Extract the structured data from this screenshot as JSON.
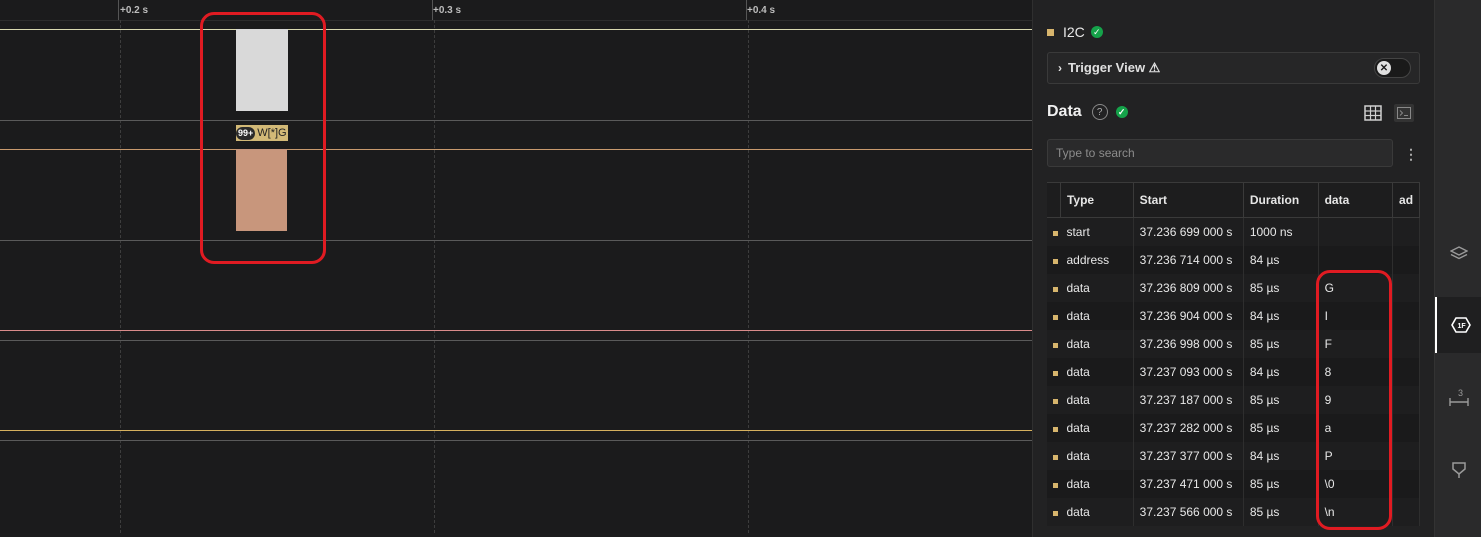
{
  "timeline": {
    "ticks": [
      "+0.2 s",
      "+0.3 s",
      "+0.4 s"
    ]
  },
  "waveform": {
    "protocol_label": "W[*]G",
    "badge": "99+"
  },
  "panel": {
    "analyzer_name": "I2C",
    "trigger_view_label": "Trigger View ⚠",
    "data_title": "Data",
    "search_placeholder": "Type to search",
    "columns": [
      "Type",
      "Start",
      "Duration",
      "data",
      "ad"
    ],
    "rows": [
      {
        "type": "start",
        "start": "37.236 699 000 s",
        "duration": "1000 ns",
        "data": ""
      },
      {
        "type": "address",
        "start": "37.236 714 000 s",
        "duration": "84 µs",
        "data": ""
      },
      {
        "type": "data",
        "start": "37.236 809 000 s",
        "duration": "85 µs",
        "data": "G"
      },
      {
        "type": "data",
        "start": "37.236 904 000 s",
        "duration": "84 µs",
        "data": "I"
      },
      {
        "type": "data",
        "start": "37.236 998 000 s",
        "duration": "85 µs",
        "data": "F"
      },
      {
        "type": "data",
        "start": "37.237 093 000 s",
        "duration": "84 µs",
        "data": "8"
      },
      {
        "type": "data",
        "start": "37.237 187 000 s",
        "duration": "85 µs",
        "data": "9"
      },
      {
        "type": "data",
        "start": "37.237 282 000 s",
        "duration": "85 µs",
        "data": "a"
      },
      {
        "type": "data",
        "start": "37.237 377 000 s",
        "duration": "84 µs",
        "data": "P"
      },
      {
        "type": "data",
        "start": "37.237 471 000 s",
        "duration": "85 µs",
        "data": "\\0"
      },
      {
        "type": "data",
        "start": "37.237 566 000 s",
        "duration": "85 µs",
        "data": "\\n"
      }
    ]
  },
  "rail": {
    "timing_marker_count": "3"
  },
  "colors": {
    "accent_i2c": "#d7b56d",
    "status_ok": "#15a34a",
    "annotation": "#e01b22"
  }
}
